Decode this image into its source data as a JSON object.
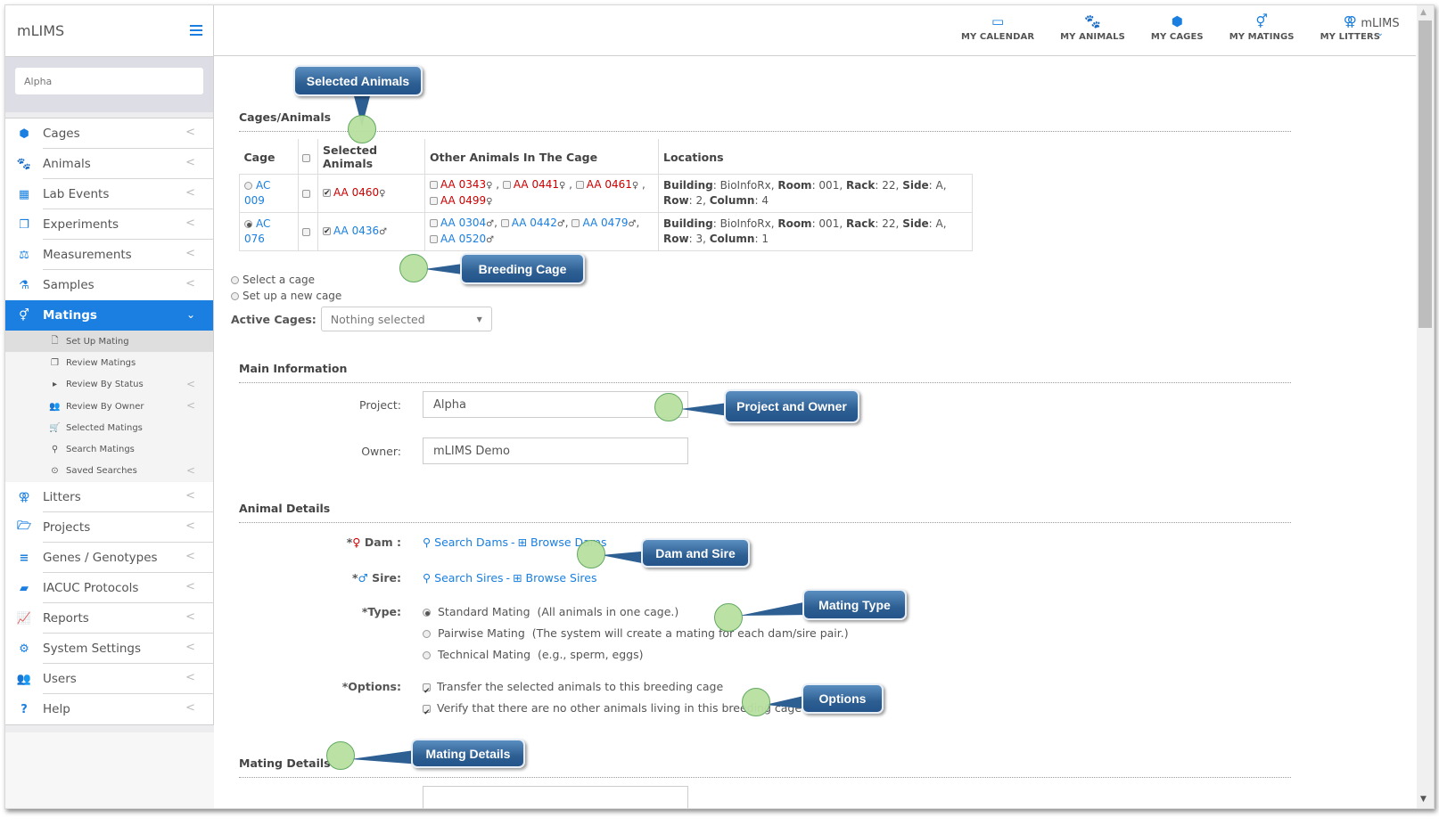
{
  "app": {
    "title": "mLIMS"
  },
  "sidebar": {
    "search_value": "Alpha",
    "items": [
      {
        "label": "Cages",
        "icon": "cube-icon"
      },
      {
        "label": "Animals",
        "icon": "paw-icon"
      },
      {
        "label": "Lab Events",
        "icon": "calendar-icon"
      },
      {
        "label": "Experiments",
        "icon": "copy-icon"
      },
      {
        "label": "Measurements",
        "icon": "balance-scale-icon"
      },
      {
        "label": "Samples",
        "icon": "flask-icon"
      },
      {
        "label": "Matings",
        "icon": "mars-venus-icon",
        "active": true
      }
    ],
    "sub_items": [
      {
        "label": "Set Up Mating",
        "icon": "file-icon",
        "current": true
      },
      {
        "label": "Review Matings",
        "icon": "clone-icon"
      },
      {
        "label": "Review By Status",
        "icon": "caret-right-icon",
        "has_children": true
      },
      {
        "label": "Review By Owner",
        "icon": "users-icon",
        "has_children": true
      },
      {
        "label": "Selected Matings",
        "icon": "cart-icon"
      },
      {
        "label": "Search Matings",
        "icon": "search-icon"
      },
      {
        "label": "Saved Searches",
        "icon": "dot-circle-icon",
        "has_children": true
      }
    ],
    "items_after": [
      {
        "label": "Litters",
        "icon": "venus-double-icon"
      },
      {
        "label": "Projects",
        "icon": "folder-open-icon"
      },
      {
        "label": "Genes / Genotypes",
        "icon": "bars-icon"
      },
      {
        "label": "IACUC Protocols",
        "icon": "book-icon"
      },
      {
        "label": "Reports",
        "icon": "line-chart-icon"
      },
      {
        "label": "System Settings",
        "icon": "gear-icon"
      },
      {
        "label": "Users",
        "icon": "users-icon"
      },
      {
        "label": "Help",
        "icon": "question-icon"
      }
    ]
  },
  "topnav": {
    "links": [
      {
        "label": "MY CALENDAR",
        "icon": "calendar-icon"
      },
      {
        "label": "MY ANIMALS",
        "icon": "paw-icon"
      },
      {
        "label": "MY CAGES",
        "icon": "cube-icon"
      },
      {
        "label": "MY MATINGS",
        "icon": "mars-venus-icon"
      },
      {
        "label": "MY LITTERS",
        "icon": "venus-double-icon"
      }
    ],
    "user": "mLIMS"
  },
  "cages_section": {
    "title": "Cages/Animals",
    "headers": [
      "Cage",
      "",
      "Selected Animals",
      "Other Animals In The Cage",
      "Locations"
    ],
    "rows": [
      {
        "cage": "AC 009",
        "selected_radio": false,
        "selected_animal": {
          "id": "AA 0460",
          "sex": "♀",
          "color": "red"
        },
        "others": [
          {
            "id": "AA 0343",
            "sex": "♀"
          },
          {
            "id": "AA 0441",
            "sex": "♀"
          },
          {
            "id": "AA 0461",
            "sex": "♀"
          },
          {
            "id": "AA 0499",
            "sex": "♀"
          }
        ],
        "others_color": "red",
        "location": {
          "building": "BioInfoRx",
          "room": "001",
          "rack": "22",
          "side": "A",
          "row": "2",
          "column": "4"
        }
      },
      {
        "cage": "AC 076",
        "selected_radio": true,
        "selected_animal": {
          "id": "AA 0436",
          "sex": "♂",
          "color": "blue"
        },
        "others": [
          {
            "id": "AA 0304",
            "sex": "♂"
          },
          {
            "id": "AA 0442",
            "sex": "♂"
          },
          {
            "id": "AA 0479",
            "sex": "♂"
          },
          {
            "id": "AA 0520",
            "sex": "♂"
          }
        ],
        "others_color": "blue",
        "location": {
          "building": "BioInfoRx",
          "room": "001",
          "rack": "22",
          "side": "A",
          "row": "3",
          "column": "1"
        }
      }
    ],
    "location_labels": {
      "building": "Building",
      "room": "Room",
      "rack": "Rack",
      "side": "Side",
      "row": "Row",
      "column": "Column"
    }
  },
  "breeding": {
    "options": [
      "Select a cage",
      "Set up a new cage"
    ],
    "active_cages_label": "Active Cages:",
    "active_cages_value": "Nothing selected"
  },
  "main_info": {
    "title": "Main Information",
    "project_label": "Project:",
    "project_value": "Alpha",
    "owner_label": "Owner:",
    "owner_value": "mLIMS Demo"
  },
  "animal_details": {
    "title": "Animal Details",
    "dam_label": "Dam :",
    "sire_label": "Sire:",
    "search_dams": "Search Dams",
    "browse_dams": "Browse Dams",
    "search_sires": "Search Sires",
    "browse_sires": "Browse Sires",
    "separator": "-",
    "type_label": "*Type:",
    "types": [
      {
        "name": "Standard Mating",
        "desc": "(All animals in one cage.)",
        "checked": true
      },
      {
        "name": "Pairwise Mating",
        "desc": "(The system will create a mating for each dam/sire pair.)",
        "checked": false
      },
      {
        "name": "Technical Mating",
        "desc": "(e.g., sperm, eggs)",
        "checked": false
      }
    ],
    "options_label": "*Options:",
    "options": [
      {
        "label": "Transfer the selected animals to this breeding cage",
        "checked": true
      },
      {
        "label": "Verify that there are no other animals living in this breeding cage",
        "checked": true
      }
    ]
  },
  "mating_details": {
    "title": "Mating Details"
  },
  "callouts": {
    "selected_animals": "Selected Animals",
    "breeding_cage": "Breeding Cage",
    "project_owner": "Project and Owner",
    "dam_sire": "Dam and Sire",
    "mating_type": "Mating Type",
    "options": "Options",
    "mating_details": "Mating Details"
  },
  "colors": {
    "accent": "#1a7fe0",
    "female_red": "#cc0000",
    "callout_blue": "#2d5f93",
    "marker_green": "#b9e0a1"
  }
}
